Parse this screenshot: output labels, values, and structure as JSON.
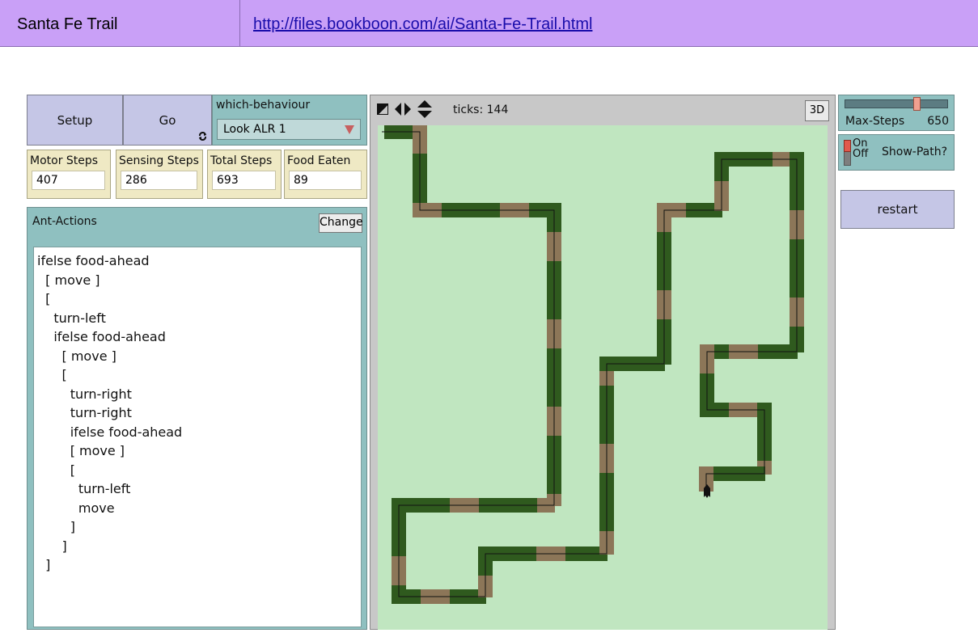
{
  "header": {
    "title": "Santa Fe Trail",
    "link": "http://files.bookboon.com/ai/Santa-Fe-Trail.html"
  },
  "buttons": {
    "setup": "Setup",
    "go": "Go",
    "restart": "restart"
  },
  "chooser": {
    "label": "which-behaviour",
    "value": "Look ALR 1"
  },
  "monitors": [
    {
      "label": "Motor Steps",
      "value": "407"
    },
    {
      "label": "Sensing Steps",
      "value": "286"
    },
    {
      "label": "Total Steps",
      "value": "693"
    },
    {
      "label": "Food Eaten",
      "value": "89"
    }
  ],
  "ant_actions": {
    "label": "Ant-Actions",
    "change_label": "Change",
    "code": [
      "ifelse food-ahead",
      "  [ move ]",
      "  [",
      "    turn-left",
      "    ifelse food-ahead",
      "      [ move ]",
      "      [",
      "        turn-right",
      "        turn-right",
      "        ifelse food-ahead",
      "        [ move ]",
      "        [",
      "          turn-left",
      "          move",
      "        ]",
      "      ]",
      "  ]"
    ]
  },
  "view": {
    "ticks_text": "ticks: 144",
    "three_d_label": "3D"
  },
  "slider": {
    "label": "Max-Steps",
    "value": "650",
    "fraction": 0.72
  },
  "switch": {
    "on_label": "On",
    "off_label": "Off",
    "name": "Show-Path?",
    "state": "on"
  },
  "colors": {
    "header_bg": "#c9a0f7",
    "link": "#1a0dab",
    "trail_dark": "#2f5a1e",
    "trail_eaten": "#8c7658",
    "world_bg": "#c0e6c0",
    "panel": "#8fc0c0",
    "monitor_bg": "#efe9c4",
    "button_bg": "#c5c6e6"
  }
}
